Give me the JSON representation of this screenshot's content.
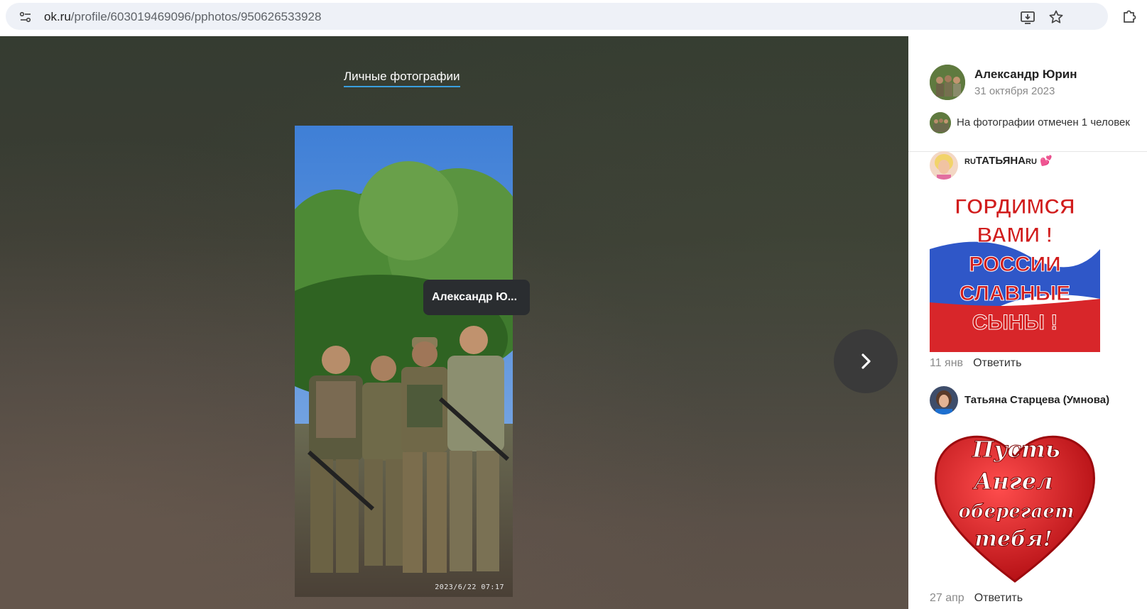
{
  "browser": {
    "url_host": "ok.ru",
    "url_path": "/profile/603019469096/pphotos/950626533928"
  },
  "viewer": {
    "album_link": "Личные фотографии",
    "photo_timestamp": "2023/6/22 07:17",
    "tag_tooltip": "Александр Ю..."
  },
  "panel": {
    "author_name": "Александр Юрин",
    "author_date": "31 октября 2023",
    "tagged_text": "На фотографии отмечен 1 человек"
  },
  "comments": [
    {
      "name_prefix": "RU",
      "name_main": "ТАТЬЯНА",
      "name_suffix": "RU",
      "emoji": "💕",
      "image_text": [
        "ГОРДИМСЯ",
        "ВАМИ !",
        "РОССИИ",
        "СЛАВНЫЕ",
        "СЫНЫ !"
      ],
      "date": "11 янв",
      "reply": "Ответить"
    },
    {
      "name": "Татьяна Старцева (Умнова)",
      "image_text": [
        "Пусть",
        "Ангел",
        "оберегает",
        "тебя!"
      ],
      "date": "27 апр",
      "reply": "Ответить"
    }
  ],
  "icons": [
    "site-settings-icon",
    "install-app-icon",
    "star-icon",
    "extensions-icon",
    "chevron-right-icon"
  ]
}
